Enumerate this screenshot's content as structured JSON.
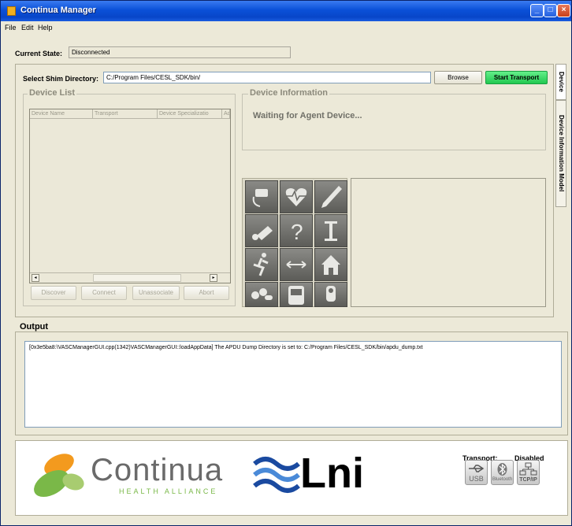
{
  "window": {
    "title": "Continua Manager",
    "minimize": "_",
    "maximize": "□",
    "close": "×"
  },
  "menu": [
    "File",
    "Edit",
    "Help"
  ],
  "current_state": {
    "label": "Current State:",
    "value": "Disconnected"
  },
  "shim": {
    "label": "Select Shim Directory:",
    "value": "C:/Program Files/CESL_SDK/bin/",
    "browse_label": "Browse",
    "start_label": "Start Transport"
  },
  "device_list": {
    "title": "Device List",
    "columns": [
      "Device Name",
      "Transport",
      "Device Specializatio",
      "Ac"
    ],
    "buttons": [
      "Discover",
      "Connect",
      "Unassociate",
      "Abort"
    ]
  },
  "device_info": {
    "title": "Device Information",
    "status": "Waiting for Agent Device..."
  },
  "device_icons": [
    "blood-pressure-icon",
    "heart-rate-icon",
    "thermometer-icon",
    "weighing-scale-icon",
    "help-icon",
    "height-scale-icon",
    "activity-icon",
    "exchange-icon",
    "home-icon",
    "medication-icon",
    "glucose-meter-icon",
    "pulse-oximeter-icon"
  ],
  "tabs": [
    "Device",
    "Device Information Model"
  ],
  "output": {
    "title": "Output",
    "line": "[0x3e5ba8:\\VASCManagerGUI.cpp(1342)VASCManagerGUI::loadAppData]  The APDU Dump Directory is set to: C:/Program Files/CESL_SDK/bin/apdu_dump.txt"
  },
  "logos": {
    "continua_name": "Continua",
    "continua_sub": "HEALTH ALLIANCE",
    "lni_text": "Lni"
  },
  "transport": {
    "label": "Transport:",
    "value": "Disabled",
    "usb": "USB",
    "bluetooth": "Bluetooth",
    "tcpip": "TCP/IP"
  },
  "colors": {
    "title_bar": "#0a50d8",
    "start_button": "#22c850",
    "continua_green": "#7ab848",
    "continua_orange": "#f39a1e",
    "lni_blue": "#1a4aa0"
  }
}
